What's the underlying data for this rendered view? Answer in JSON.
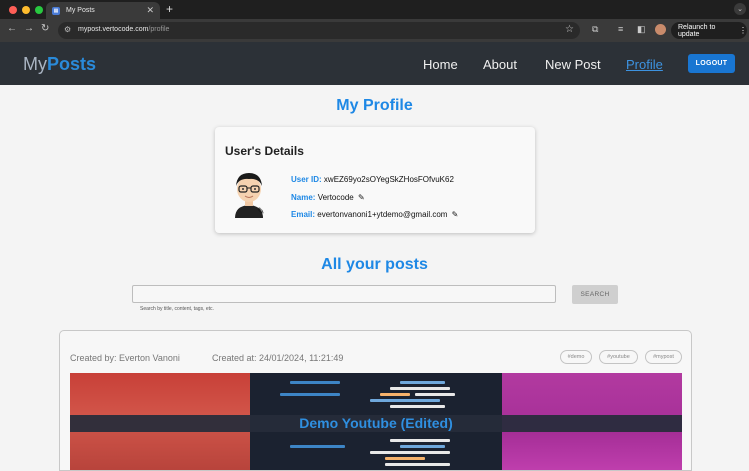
{
  "browser": {
    "tab_title": "My Posts",
    "url_host": "mypost.vertocode.com",
    "url_path": "/profile",
    "relaunch_label": "Relaunch to update"
  },
  "navbar": {
    "brand_prefix": "My",
    "brand_suffix": "Posts",
    "links": [
      "Home",
      "About",
      "New Post",
      "Profile"
    ],
    "active_link": "Profile",
    "logout_label": "LOGOUT"
  },
  "profile": {
    "title": "My Profile",
    "details_heading": "User's Details",
    "user_id_label": "User ID:",
    "user_id": "xwEZ69yo2sOYegSkZHosFOfvuK62",
    "name_label": "Name:",
    "name": "Vertocode",
    "email_label": "Email:",
    "email": "evertonvanoni1+ytdemo@gmail.com"
  },
  "posts": {
    "title": "All your posts",
    "search_placeholder": "",
    "search_hint": "Search by title, content, tags, etc.",
    "search_button": "SEARCH",
    "items": [
      {
        "created_by": "Created by: Everton Vanoni",
        "created_at": "Created at: 24/01/2024, 11:21:49",
        "tags": [
          "#demo",
          "#youtube",
          "#mypost"
        ],
        "title": "Demo Youtube (Edited)"
      }
    ]
  },
  "colors": {
    "accent": "#1e88e5",
    "navbar_bg": "#2c3137",
    "logout_bg": "#1976d2"
  }
}
